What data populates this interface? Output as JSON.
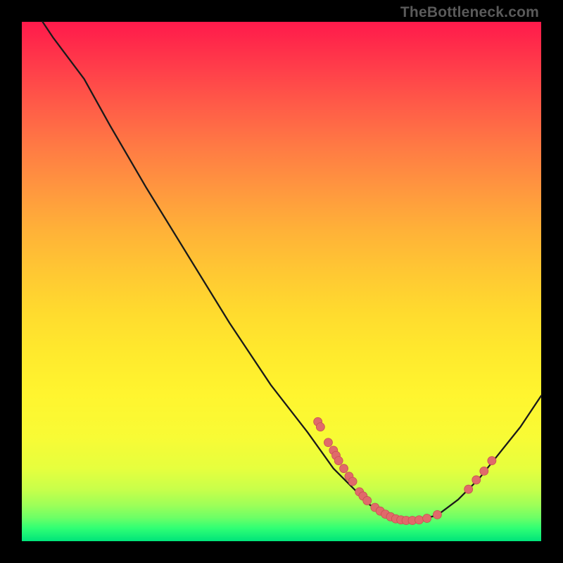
{
  "watermark": "TheBottleneck.com",
  "chart_data": {
    "type": "line",
    "title": "",
    "xlabel": "",
    "ylabel": "",
    "xlim": [
      0,
      100
    ],
    "ylim": [
      0,
      100
    ],
    "curve": [
      {
        "x": 4,
        "y": 100
      },
      {
        "x": 6,
        "y": 97
      },
      {
        "x": 9,
        "y": 93
      },
      {
        "x": 12,
        "y": 89
      },
      {
        "x": 17,
        "y": 80
      },
      {
        "x": 24,
        "y": 68
      },
      {
        "x": 32,
        "y": 55
      },
      {
        "x": 40,
        "y": 42
      },
      {
        "x": 48,
        "y": 30
      },
      {
        "x": 55,
        "y": 21
      },
      {
        "x": 60,
        "y": 14
      },
      {
        "x": 64,
        "y": 10
      },
      {
        "x": 67,
        "y": 7
      },
      {
        "x": 70,
        "y": 5
      },
      {
        "x": 73,
        "y": 4
      },
      {
        "x": 76,
        "y": 4
      },
      {
        "x": 80,
        "y": 5
      },
      {
        "x": 84,
        "y": 8
      },
      {
        "x": 88,
        "y": 12
      },
      {
        "x": 92,
        "y": 17
      },
      {
        "x": 96,
        "y": 22
      },
      {
        "x": 100,
        "y": 28
      }
    ],
    "points": [
      {
        "x": 57,
        "y": 23
      },
      {
        "x": 57.5,
        "y": 22
      },
      {
        "x": 59,
        "y": 19
      },
      {
        "x": 60,
        "y": 17.5
      },
      {
        "x": 60.5,
        "y": 16.5
      },
      {
        "x": 61,
        "y": 15.5
      },
      {
        "x": 62,
        "y": 14
      },
      {
        "x": 63,
        "y": 12.5
      },
      {
        "x": 63.7,
        "y": 11.5
      },
      {
        "x": 65,
        "y": 9.5
      },
      {
        "x": 65.7,
        "y": 8.7
      },
      {
        "x": 66.5,
        "y": 7.8
      },
      {
        "x": 68,
        "y": 6.5
      },
      {
        "x": 69,
        "y": 5.8
      },
      {
        "x": 70,
        "y": 5.2
      },
      {
        "x": 71,
        "y": 4.7
      },
      {
        "x": 72,
        "y": 4.3
      },
      {
        "x": 73,
        "y": 4.1
      },
      {
        "x": 74,
        "y": 4.0
      },
      {
        "x": 75.2,
        "y": 4.0
      },
      {
        "x": 76.5,
        "y": 4.1
      },
      {
        "x": 78,
        "y": 4.4
      },
      {
        "x": 80,
        "y": 5.1
      },
      {
        "x": 86,
        "y": 10
      },
      {
        "x": 87.5,
        "y": 11.8
      },
      {
        "x": 89,
        "y": 13.5
      },
      {
        "x": 90.5,
        "y": 15.5
      }
    ],
    "colors": {
      "curve": "#1a1a1a",
      "point_fill": "#e06a6a",
      "point_stroke": "#c75050"
    }
  }
}
